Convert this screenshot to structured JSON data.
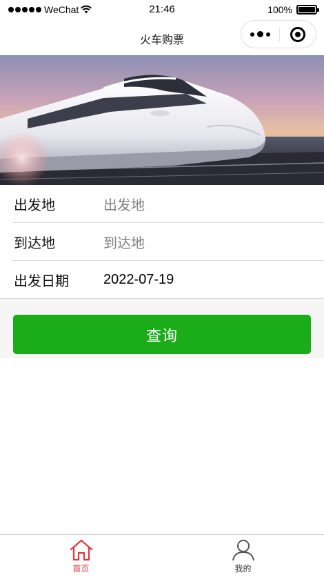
{
  "status_bar": {
    "carrier": "WeChat",
    "time": "21:46",
    "battery": "100%"
  },
  "nav": {
    "title": "火车购票"
  },
  "banner": {
    "image": "high-speed-train"
  },
  "form": {
    "departure": {
      "label": "出发地",
      "placeholder": "出发地"
    },
    "arrival": {
      "label": "到达地",
      "placeholder": "到达地"
    },
    "date": {
      "label": "出发日期",
      "value": "2022-07-19"
    }
  },
  "query_button": {
    "label": "查询",
    "color": "#1aad19"
  },
  "tab_bar": {
    "tabs": [
      {
        "label": "首页",
        "icon": "home-icon",
        "active": true,
        "color": "#e0383e"
      },
      {
        "label": "我的",
        "icon": "user-icon",
        "active": false,
        "color": "#333333"
      }
    ]
  }
}
